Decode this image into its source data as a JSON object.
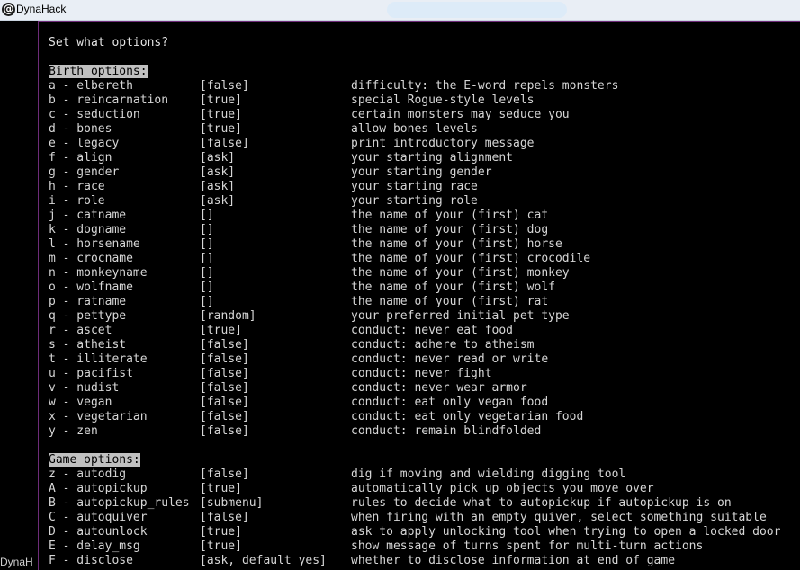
{
  "window": {
    "title": "DynaHack",
    "app_icon": "at-sign-icon",
    "taskbar_label": "DynaH"
  },
  "menu": {
    "prompt": "Set what options?",
    "sections": [
      {
        "heading": "Birth options:",
        "rows": [
          {
            "key": "a - elbereth",
            "value": "[false]",
            "desc": "difficulty: the E-word repels monsters"
          },
          {
            "key": "b - reincarnation",
            "value": "[true]",
            "desc": "special Rogue-style levels"
          },
          {
            "key": "c - seduction",
            "value": "[true]",
            "desc": "certain monsters may seduce you"
          },
          {
            "key": "d - bones",
            "value": "[true]",
            "desc": "allow bones levels"
          },
          {
            "key": "e - legacy",
            "value": "[false]",
            "desc": "print introductory message"
          },
          {
            "key": "f - align",
            "value": "[ask]",
            "desc": "your starting alignment"
          },
          {
            "key": "g - gender",
            "value": "[ask]",
            "desc": "your starting gender"
          },
          {
            "key": "h - race",
            "value": "[ask]",
            "desc": "your starting race"
          },
          {
            "key": "i - role",
            "value": "[ask]",
            "desc": "your starting role"
          },
          {
            "key": "j - catname",
            "value": "[]",
            "desc": "the name of your (first) cat"
          },
          {
            "key": "k - dogname",
            "value": "[]",
            "desc": "the name of your (first) dog"
          },
          {
            "key": "l - horsename",
            "value": "[]",
            "desc": "the name of your (first) horse"
          },
          {
            "key": "m - crocname",
            "value": "[]",
            "desc": "the name of your (first) crocodile"
          },
          {
            "key": "n - monkeyname",
            "value": "[]",
            "desc": "the name of your (first) monkey"
          },
          {
            "key": "o - wolfname",
            "value": "[]",
            "desc": "the name of your (first) wolf"
          },
          {
            "key": "p - ratname",
            "value": "[]",
            "desc": "the name of your (first) rat"
          },
          {
            "key": "q - pettype",
            "value": "[random]",
            "desc": "your preferred initial pet type"
          },
          {
            "key": "r - ascet",
            "value": "[true]",
            "desc": "conduct: never eat food"
          },
          {
            "key": "s - atheist",
            "value": "[false]",
            "desc": "conduct: adhere to atheism"
          },
          {
            "key": "t - illiterate",
            "value": "[false]",
            "desc": "conduct: never read or write"
          },
          {
            "key": "u - pacifist",
            "value": "[false]",
            "desc": "conduct: never fight"
          },
          {
            "key": "v - nudist",
            "value": "[false]",
            "desc": "conduct: never wear armor"
          },
          {
            "key": "w - vegan",
            "value": "[false]",
            "desc": "conduct: eat only vegan food"
          },
          {
            "key": "x - vegetarian",
            "value": "[false]",
            "desc": "conduct: eat only vegetarian food"
          },
          {
            "key": "y - zen",
            "value": "[false]",
            "desc": "conduct: remain blindfolded"
          }
        ]
      },
      {
        "heading": "Game options:",
        "rows": [
          {
            "key": "z - autodig",
            "value": "[false]",
            "desc": "dig if moving and wielding digging tool"
          },
          {
            "key": "A - autopickup",
            "value": "[true]",
            "desc": "automatically pick up objects you move over"
          },
          {
            "key": "B - autopickup_rules",
            "value": "[submenu]",
            "desc": "rules to decide what to autopickup if autopickup is on"
          },
          {
            "key": "C - autoquiver",
            "value": "[false]",
            "desc": "when firing with an empty quiver, select something suitable"
          },
          {
            "key": "D - autounlock",
            "value": "[true]",
            "desc": "ask to apply unlocking tool when trying to open a locked door"
          },
          {
            "key": "E - delay_msg",
            "value": "[true]",
            "desc": "show message of turns spent for multi-turn actions"
          },
          {
            "key": "F - disclose",
            "value": "[ask, default yes]",
            "desc": "whether to disclose information at end of game"
          }
        ]
      }
    ]
  },
  "colors": {
    "background": "#000000",
    "text": "#d6d6d6",
    "heading_bg": "#c0c0c0",
    "border": "#6e2c79"
  }
}
